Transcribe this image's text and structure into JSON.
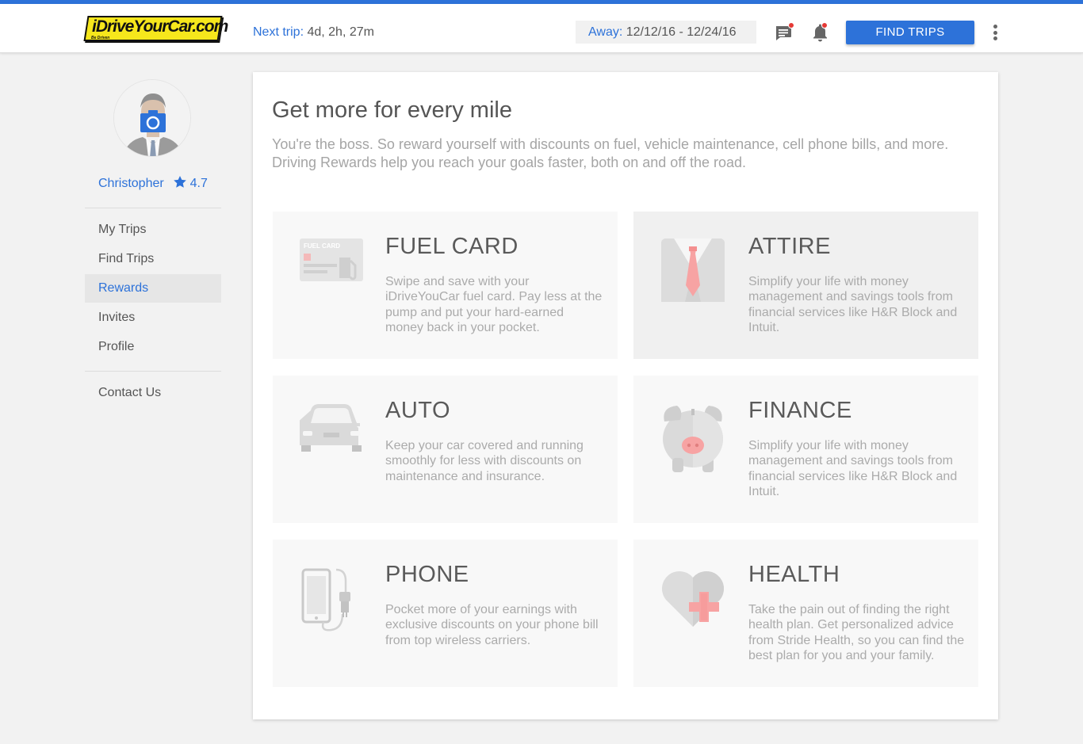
{
  "header": {
    "logo_text": "iDriveYourCar.com",
    "logo_tagline": "Be Driven",
    "next_trip_label": "Next trip:",
    "next_trip_value": " 4d, 2h, 27m",
    "away_label": "Away:",
    "away_value": " 12/12/16 - 12/24/16",
    "find_trips_label": "FIND TRIPS",
    "icons": [
      "message-icon",
      "bell-icon",
      "more-vert-icon"
    ]
  },
  "sidebar": {
    "user_name": "Christopher",
    "rating": "4.7",
    "rating_icon": "star-icon",
    "nav": [
      {
        "label": "My Trips",
        "active": false
      },
      {
        "label": "Find Trips",
        "active": false
      },
      {
        "label": "Rewards",
        "active": true
      },
      {
        "label": "Invites",
        "active": false
      },
      {
        "label": "Profile",
        "active": false
      }
    ],
    "contact_label": "Contact Us"
  },
  "main": {
    "title": "Get more for every mile",
    "description": "You're the boss. So reward yourself with discounts on fuel, vehicle maintenance, cell phone bills, and more. Driving Rewards help you reach your goals faster, both on and off the road.",
    "rewards": [
      {
        "title": "FUEL CARD",
        "description": "Swipe and save with your iDriveYouCar fuel card. Pay less at the pump and put your hard-earned money back in your pocket.",
        "icon": "fuel-card-icon",
        "icon_text": "FUEL CARD"
      },
      {
        "title": "ATTIRE",
        "description": "Simplify your life with money management and savings tools from financial services like H&R Block and Intuit.",
        "icon": "suit-icon"
      },
      {
        "title": "AUTO",
        "description": "Keep your car covered and running smoothly for less with discounts on maintenance and insurance.",
        "icon": "car-icon"
      },
      {
        "title": "FINANCE",
        "description": "Simplify your life with money management and savings tools from financial services like H&R Block and Intuit.",
        "icon": "piggy-bank-icon"
      },
      {
        "title": "PHONE",
        "description": "Pocket more of your earnings with exclusive discounts on your phone bill from top wireless carriers.",
        "icon": "phone-charger-icon"
      },
      {
        "title": "HEALTH",
        "description": "Take the pain out of finding the right health plan. Get personalized advice from Stride Health, so you can find the best plan for you and your family.",
        "icon": "heart-cross-icon"
      }
    ]
  },
  "colors": {
    "accent": "#2d72d9",
    "logo_yellow": "#f6e71c",
    "notification_red": "#e53935",
    "pink_accent": "#f7a3a3"
  }
}
